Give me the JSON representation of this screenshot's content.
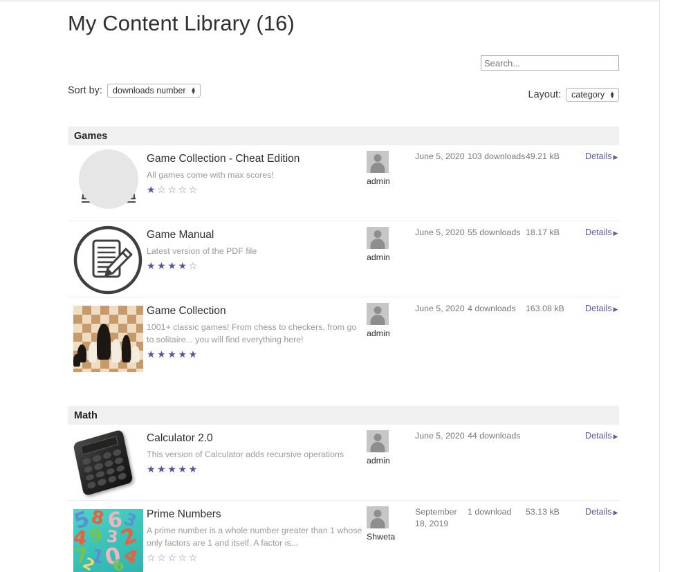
{
  "page": {
    "title": "My Content Library (16)"
  },
  "search": {
    "placeholder": "Search...",
    "value": "",
    "name": "search-input"
  },
  "controls": {
    "sort_label": "Sort by:",
    "sort_value": "downloads number",
    "layout_label": "Layout:",
    "layout_value": "category"
  },
  "colors": {
    "star_filled": "#55559b",
    "star_empty": "#8b8bbd",
    "details_link": "#5b5b9e",
    "section_header_bg": "#f0f0f0",
    "row_divider": "#ececec",
    "muted_text": "#777777",
    "description_text": "#9a9a9a"
  },
  "labels": {
    "details": "Details",
    "details_caret": "▶",
    "star_filled_glyph": "★",
    "star_empty_glyph": "☆"
  },
  "categories": [
    {
      "name": "Games",
      "items": [
        {
          "title": "Game Collection - Cheat Edition",
          "description": "All games come with max scores!",
          "rating": 1,
          "rating_max": 5,
          "author": "admin",
          "date": "June 5, 2020",
          "downloads": "103 downloads",
          "size": "49.21 kB",
          "details": "Details",
          "thumb": "gauge-icon"
        },
        {
          "title": "Game Manual",
          "description": "Latest version of the PDF file",
          "rating": 4,
          "rating_max": 5,
          "author": "admin",
          "date": "June 5, 2020",
          "downloads": "55 downloads",
          "size": "18.17 kB",
          "details": "Details",
          "thumb": "document-pencil-icon"
        },
        {
          "title": "Game Collection",
          "description": "1001+ classic games! From chess to checkers, from go to solitaire... you will find everything here!",
          "rating": 5,
          "rating_max": 5,
          "author": "admin",
          "date": "June 5, 2020",
          "downloads": "4 downloads",
          "size": "163.08 kB",
          "details": "Details",
          "thumb": "chess-board-image"
        }
      ]
    },
    {
      "name": "Math",
      "items": [
        {
          "title": "Calculator 2.0",
          "description": "This version of Calculator adds recursive operations",
          "rating": 5,
          "rating_max": 5,
          "author": "admin",
          "date": "June 5, 2020",
          "downloads": "44 downloads",
          "size": "",
          "details": "Details",
          "thumb": "calculator-image"
        },
        {
          "title": "Prime Numbers",
          "description": "A prime number is a whole number greater than 1 whose only factors are 1 and itself. A factor is...",
          "rating": 0,
          "rating_max": 5,
          "author": "Shweta",
          "date": "September 18, 2019",
          "downloads": "1 download",
          "size": "53.13 kB",
          "details": "Details",
          "thumb": "foam-numbers-image"
        }
      ]
    }
  ]
}
